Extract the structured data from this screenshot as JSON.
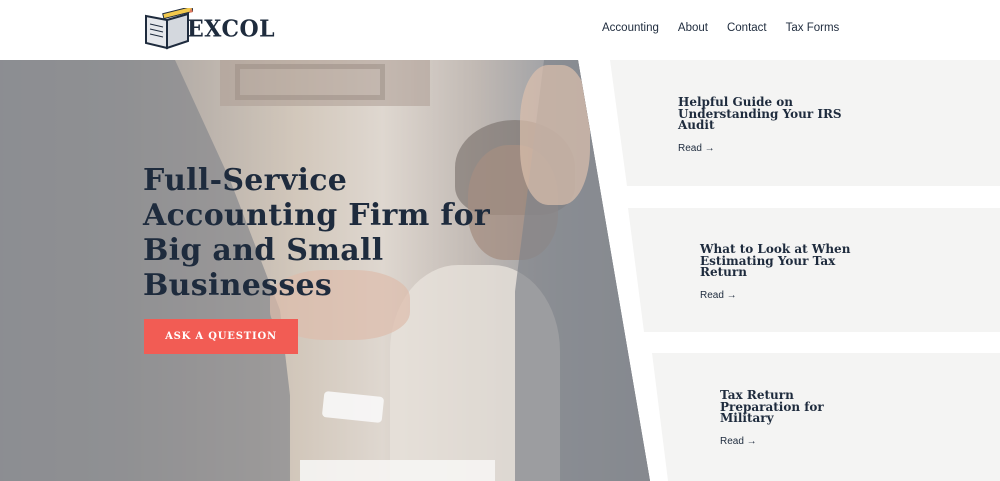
{
  "brand": {
    "name": "EXCOL"
  },
  "nav": {
    "items": [
      "Accounting",
      "About",
      "Contact",
      "Tax Forms"
    ]
  },
  "hero": {
    "title_lines": [
      "Full-Service",
      "Accounting Firm for",
      "Big and Small",
      "Businesses"
    ],
    "cta_label": "ASK A QUESTION"
  },
  "cards": [
    {
      "title_lines": [
        "Helpful Guide on",
        "Understanding Your IRS",
        "Audit"
      ],
      "link": "Read →"
    },
    {
      "title_lines": [
        "What to Look at When",
        "Estimating Your Tax",
        "Return"
      ],
      "link": "Read →"
    },
    {
      "title_lines": [
        "Tax Return",
        "Preparation for",
        "Military"
      ],
      "link": "Read →"
    }
  ],
  "colors": {
    "accent": "#f25c54",
    "navy": "#1e2b3d",
    "card_bg": "#f4f4f3"
  }
}
